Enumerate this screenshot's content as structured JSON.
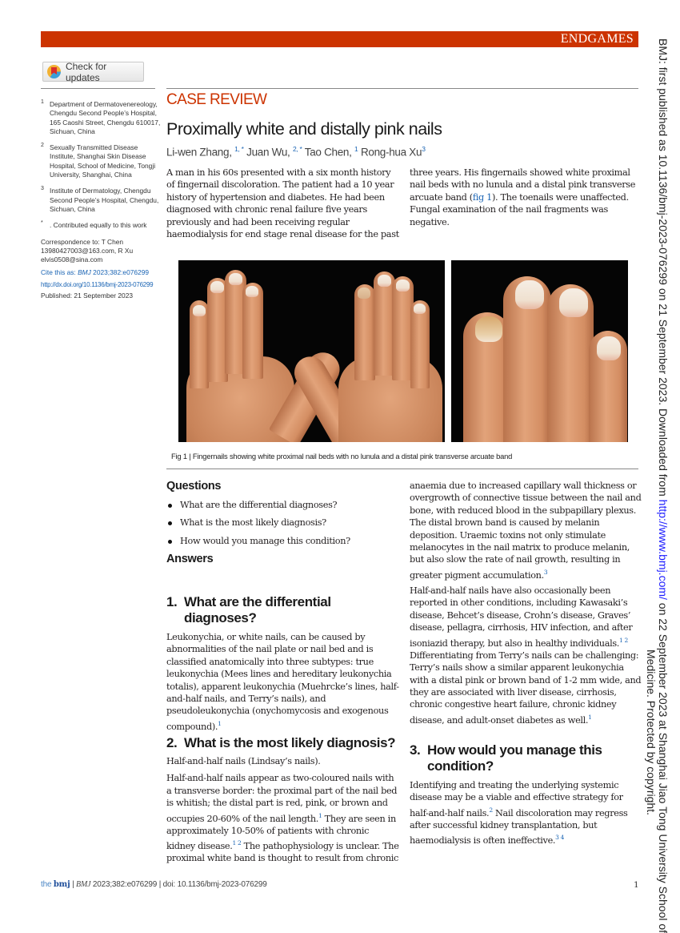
{
  "header": {
    "section_label": "ENDGAMES",
    "check_updates_label": "Check for updates",
    "accent_color": "#cc3300"
  },
  "sidebar": {
    "affiliations": [
      {
        "num": "1",
        "text": "Department of Dermatovenereology, Chengdu Second People’s Hospital, 165 Caoshi Street, Chengdu 610017, Sichuan, China"
      },
      {
        "num": "2",
        "text": "Sexually Transmitted Disease Institute, Shanghai Skin Disease Hospital, School of Medicine, Tongji University, Shanghai, China"
      },
      {
        "num": "3",
        "text": "Institute of Dermatology, Chengdu Second People’s Hospital, Chengdu, Sichuan, China"
      },
      {
        "num": "*",
        "text": ". Contributed equally to this work"
      }
    ],
    "correspondence": "Correspondence to: T Chen 13980427003@163.com, R Xu elvis0508@sina.com",
    "cite_prefix": "Cite this as: ",
    "cite_journal": "BMJ",
    "cite_ref": " 2023;382:e076299",
    "doi_link": "http://dx.doi.org/10.1136/bmj-2023-076299",
    "published": "Published: 21 September 2023"
  },
  "article": {
    "kicker": "CASE REVIEW",
    "title": "Proximally white and distally pink nails",
    "authors": [
      {
        "name": "Li-wen Zhang, ",
        "sup": "1, *"
      },
      {
        "name": " Juan Wu, ",
        "sup": "2, *"
      },
      {
        "name": " Tao Chen, ",
        "sup": "1"
      },
      {
        "name": " Rong-hua Xu",
        "sup": "3"
      }
    ],
    "intro_a": "A man in his 60s presented with a six month history of fingernail discoloration. The patient had a 10 year history of hypertension and diabetes. He had been diagnosed with chronic renal failure five years previously and had been receiving regular haemodialysis for end stage renal disease for the past",
    "intro_b_1": "three years. His fingernails showed white proximal nail beds with no lunula and a distal pink transverse arcuate band (",
    "intro_b_link": "fig 1",
    "intro_b_2": "). The toenails were unaffected. Fungal examination of the nail fragments was negative.",
    "figure_caption": "Fig 1 | Fingernails showing white proximal nail beds with no lunula and a distal pink transverse arcuate band",
    "questions_heading": "Questions",
    "questions": [
      "What are the differential diagnoses?",
      "What is the most likely diagnosis?",
      "How would you manage this condition?"
    ],
    "answers_heading": "Answers",
    "q1": {
      "num": "1.",
      "heading": "What are the differential diagnoses?",
      "text": "Leukonychia, or white nails, can be caused by abnormalities of the nail plate or nail bed and is classified anatomically into three subtypes: true leukonychia (Mees lines and hereditary leukonychia totalis), apparent leukonychia (Muehrcke’s lines, half-and-half nails, and Terry’s nails), and pseudoleukonychia (onychomycosis and exogenous compound).",
      "ref": "1"
    },
    "q2": {
      "num": "2.",
      "heading": "What is the most likely diagnosis?",
      "answer": "Half-and-half nails (Lindsay’s nails).",
      "p1_a": "Half-and-half nails appear as two-coloured nails with a transverse border: the proximal part of the nail bed is whitish; the distal part is red, pink, or brown and occupies 20-60% of the nail length.",
      "p1_ref1": "1",
      "p1_b": " They are seen in approximately 10-50% of patients with chronic kidney disease.",
      "p1_ref2": "1 2",
      "p1_c": " The pathophysiology is unclear. The proximal white band is thought to result from chronic",
      "p2_a": "anaemia due to increased capillary wall thickness or overgrowth of connective tissue between the nail and bone, with reduced blood in the subpapillary plexus. The distal brown band is caused by melanin deposition. Uraemic toxins not only stimulate melanocytes in the nail matrix to produce melanin, but also slow the rate of nail growth, resulting in greater pigment accumulation.",
      "p2_ref": "3",
      "p3_a": "Half-and-half nails have also occasionally been reported in other conditions, including Kawasaki’s disease, Behcet’s disease, Crohn’s disease, Graves’ disease, pellagra, cirrhosis, HIV infection, and after isoniazid therapy, but also in healthy individuals.",
      "p3_ref1": "1 2",
      "p3_b": " Differentiating from Terry’s nails can be challenging: Terry’s nails show a similar apparent leukonychia with a distal pink or brown band of 1-2 mm wide, and they are associated with liver disease, cirrhosis, chronic congestive heart failure, chronic kidney disease, and adult-onset diabetes as well.",
      "p3_ref2": "1"
    },
    "q3": {
      "num": "3.",
      "heading": "How would you manage this condition?",
      "text_a": "Identifying and treating the underlying systemic disease may be a viable and effective strategy for half-and-half nails.",
      "ref1": "2",
      "text_b": " Nail discoloration may regress after successful kidney transplantation, but haemodialysis is often ineffective.",
      "ref2": "3 4"
    }
  },
  "footer": {
    "the": "the ",
    "bmj": "bmj",
    "sep": " | ",
    "journal": "BMJ",
    "ref": " 2023;382:e076299 | doi: 10.1136/bmj-2023-076299",
    "page": "1"
  },
  "side_note": {
    "text_1": "BMJ: first published as 10.1136/bmj-2023-076299 on 21 September 2023. Downloaded from ",
    "url": "http://www.bmj.com/",
    "text_2": " on 22 September 2023 at Shanghai Jiao Tong University School of",
    "line2": "Medicine. Protected by copyright."
  }
}
